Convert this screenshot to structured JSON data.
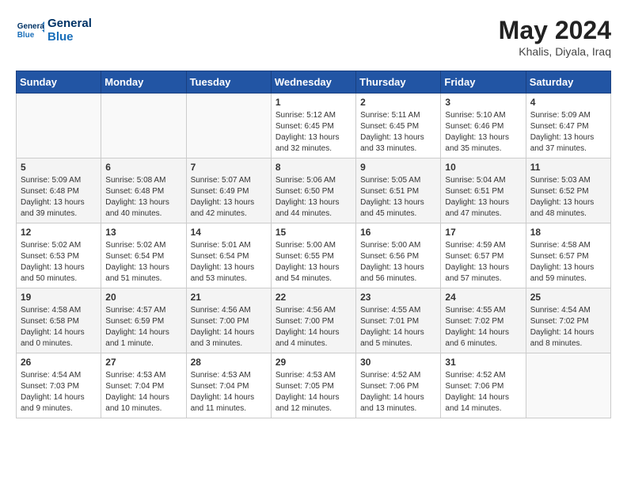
{
  "header": {
    "logo_line1": "General",
    "logo_line2": "Blue",
    "month_year": "May 2024",
    "location": "Khalis, Diyala, Iraq"
  },
  "weekdays": [
    "Sunday",
    "Monday",
    "Tuesday",
    "Wednesday",
    "Thursday",
    "Friday",
    "Saturday"
  ],
  "weeks": [
    [
      {
        "day": "",
        "info": ""
      },
      {
        "day": "",
        "info": ""
      },
      {
        "day": "",
        "info": ""
      },
      {
        "day": "1",
        "info": "Sunrise: 5:12 AM\nSunset: 6:45 PM\nDaylight: 13 hours\nand 32 minutes."
      },
      {
        "day": "2",
        "info": "Sunrise: 5:11 AM\nSunset: 6:45 PM\nDaylight: 13 hours\nand 33 minutes."
      },
      {
        "day": "3",
        "info": "Sunrise: 5:10 AM\nSunset: 6:46 PM\nDaylight: 13 hours\nand 35 minutes."
      },
      {
        "day": "4",
        "info": "Sunrise: 5:09 AM\nSunset: 6:47 PM\nDaylight: 13 hours\nand 37 minutes."
      }
    ],
    [
      {
        "day": "5",
        "info": "Sunrise: 5:09 AM\nSunset: 6:48 PM\nDaylight: 13 hours\nand 39 minutes."
      },
      {
        "day": "6",
        "info": "Sunrise: 5:08 AM\nSunset: 6:48 PM\nDaylight: 13 hours\nand 40 minutes."
      },
      {
        "day": "7",
        "info": "Sunrise: 5:07 AM\nSunset: 6:49 PM\nDaylight: 13 hours\nand 42 minutes."
      },
      {
        "day": "8",
        "info": "Sunrise: 5:06 AM\nSunset: 6:50 PM\nDaylight: 13 hours\nand 44 minutes."
      },
      {
        "day": "9",
        "info": "Sunrise: 5:05 AM\nSunset: 6:51 PM\nDaylight: 13 hours\nand 45 minutes."
      },
      {
        "day": "10",
        "info": "Sunrise: 5:04 AM\nSunset: 6:51 PM\nDaylight: 13 hours\nand 47 minutes."
      },
      {
        "day": "11",
        "info": "Sunrise: 5:03 AM\nSunset: 6:52 PM\nDaylight: 13 hours\nand 48 minutes."
      }
    ],
    [
      {
        "day": "12",
        "info": "Sunrise: 5:02 AM\nSunset: 6:53 PM\nDaylight: 13 hours\nand 50 minutes."
      },
      {
        "day": "13",
        "info": "Sunrise: 5:02 AM\nSunset: 6:54 PM\nDaylight: 13 hours\nand 51 minutes."
      },
      {
        "day": "14",
        "info": "Sunrise: 5:01 AM\nSunset: 6:54 PM\nDaylight: 13 hours\nand 53 minutes."
      },
      {
        "day": "15",
        "info": "Sunrise: 5:00 AM\nSunset: 6:55 PM\nDaylight: 13 hours\nand 54 minutes."
      },
      {
        "day": "16",
        "info": "Sunrise: 5:00 AM\nSunset: 6:56 PM\nDaylight: 13 hours\nand 56 minutes."
      },
      {
        "day": "17",
        "info": "Sunrise: 4:59 AM\nSunset: 6:57 PM\nDaylight: 13 hours\nand 57 minutes."
      },
      {
        "day": "18",
        "info": "Sunrise: 4:58 AM\nSunset: 6:57 PM\nDaylight: 13 hours\nand 59 minutes."
      }
    ],
    [
      {
        "day": "19",
        "info": "Sunrise: 4:58 AM\nSunset: 6:58 PM\nDaylight: 14 hours\nand 0 minutes."
      },
      {
        "day": "20",
        "info": "Sunrise: 4:57 AM\nSunset: 6:59 PM\nDaylight: 14 hours\nand 1 minute."
      },
      {
        "day": "21",
        "info": "Sunrise: 4:56 AM\nSunset: 7:00 PM\nDaylight: 14 hours\nand 3 minutes."
      },
      {
        "day": "22",
        "info": "Sunrise: 4:56 AM\nSunset: 7:00 PM\nDaylight: 14 hours\nand 4 minutes."
      },
      {
        "day": "23",
        "info": "Sunrise: 4:55 AM\nSunset: 7:01 PM\nDaylight: 14 hours\nand 5 minutes."
      },
      {
        "day": "24",
        "info": "Sunrise: 4:55 AM\nSunset: 7:02 PM\nDaylight: 14 hours\nand 6 minutes."
      },
      {
        "day": "25",
        "info": "Sunrise: 4:54 AM\nSunset: 7:02 PM\nDaylight: 14 hours\nand 8 minutes."
      }
    ],
    [
      {
        "day": "26",
        "info": "Sunrise: 4:54 AM\nSunset: 7:03 PM\nDaylight: 14 hours\nand 9 minutes."
      },
      {
        "day": "27",
        "info": "Sunrise: 4:53 AM\nSunset: 7:04 PM\nDaylight: 14 hours\nand 10 minutes."
      },
      {
        "day": "28",
        "info": "Sunrise: 4:53 AM\nSunset: 7:04 PM\nDaylight: 14 hours\nand 11 minutes."
      },
      {
        "day": "29",
        "info": "Sunrise: 4:53 AM\nSunset: 7:05 PM\nDaylight: 14 hours\nand 12 minutes."
      },
      {
        "day": "30",
        "info": "Sunrise: 4:52 AM\nSunset: 7:06 PM\nDaylight: 14 hours\nand 13 minutes."
      },
      {
        "day": "31",
        "info": "Sunrise: 4:52 AM\nSunset: 7:06 PM\nDaylight: 14 hours\nand 14 minutes."
      },
      {
        "day": "",
        "info": ""
      }
    ]
  ]
}
